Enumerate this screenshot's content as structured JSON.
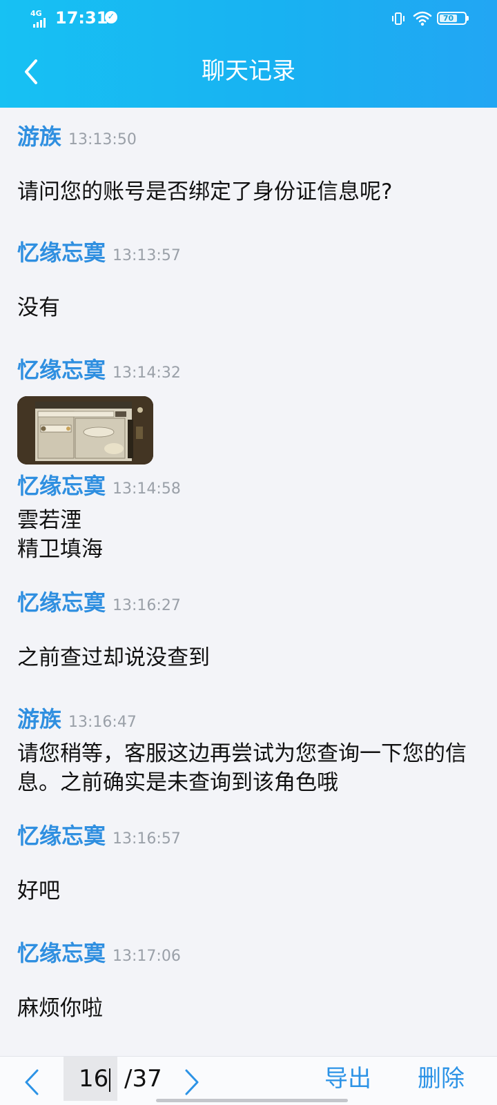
{
  "status_bar": {
    "network": "4G",
    "time": "17:31",
    "battery": "70",
    "battery_fraction": 0.7
  },
  "header": {
    "title": "聊天记录"
  },
  "messages": [
    {
      "sender": "游族",
      "time": "13:13:50",
      "text": "请问您的账号是否绑定了身份证信息呢?"
    },
    {
      "sender": "忆缘忘寞",
      "time": "13:13:57",
      "text": "没有"
    },
    {
      "sender": "忆缘忘寞",
      "time": "13:14:32",
      "text": "",
      "has_image": true
    },
    {
      "sender": "忆缘忘寞",
      "time": "13:14:58",
      "text": "雲若湮\n精卫填海"
    },
    {
      "sender": "忆缘忘寞",
      "time": "13:16:27",
      "text": "之前查过却说没查到"
    },
    {
      "sender": "游族",
      "time": "13:16:47",
      "text": "请您稍等，客服这边再尝试为您查询一下您的信息。之前确实是未查询到该角色哦"
    },
    {
      "sender": "忆缘忘寞",
      "time": "13:16:57",
      "text": "好吧"
    },
    {
      "sender": "忆缘忘寞",
      "time": "13:17:06",
      "text": "麻烦你啦"
    }
  ],
  "footer": {
    "current_page": "16",
    "total_pages": "/37",
    "export_label": "导出",
    "delete_label": "删除"
  },
  "colors": {
    "header_gradient_start": "#17c1f3",
    "header_gradient_end": "#22a6f3",
    "sender_name": "#2f8fe0",
    "timestamp": "#9aa0a8",
    "background": "#f3f4f8",
    "accent": "#2c93e6"
  }
}
